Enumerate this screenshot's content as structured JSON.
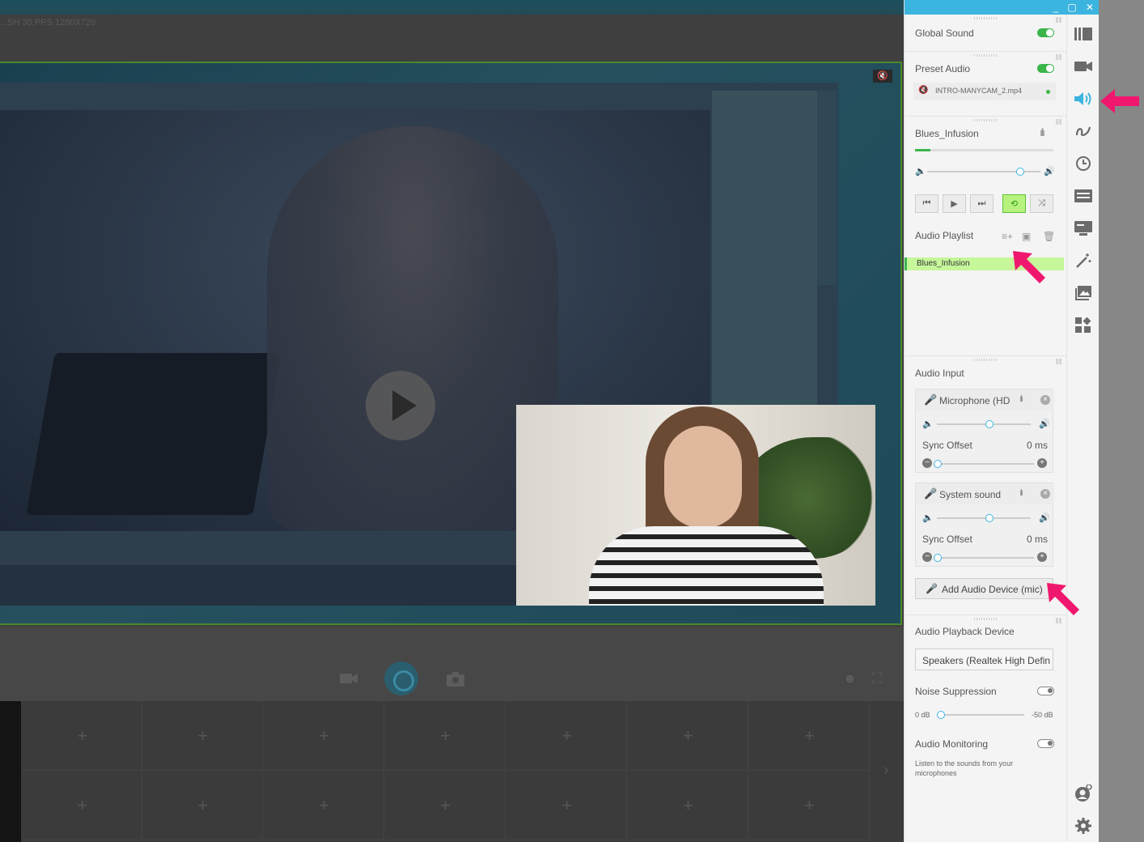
{
  "stage": {
    "stats_text": "...SH 30.PPS 1280X720",
    "bottom_controls": [
      "camera-icon",
      "broadcast-icon",
      "snapshot-icon"
    ],
    "grid_plus": "+",
    "next_arrow": "›"
  },
  "panel": {
    "window_buttons": {
      "minimize": "_",
      "maximize": "▢",
      "close": "✕"
    },
    "global_sound": {
      "label": "Global Sound",
      "enabled": true
    },
    "preset_audio": {
      "label": "Preset Audio",
      "enabled": true,
      "file": "INTRO-MANYCAM_2.mp4"
    },
    "player": {
      "track": "Blues_Infusion",
      "progress_fraction": 0.11,
      "volume_fraction": 0.84,
      "buttons": [
        "⏮",
        "▶",
        "⏭",
        "⟲",
        "⤨"
      ]
    },
    "playlist": {
      "label": "Audio Playlist",
      "items": [
        "Blues_Infusion"
      ]
    },
    "audio_input": {
      "label": "Audio Input",
      "devices": [
        {
          "name": "Microphone (HD",
          "volume_fraction": 0.55,
          "sync_label": "Sync Offset",
          "sync_value": "0 ms"
        },
        {
          "name": "System sound",
          "volume_fraction": 0.55,
          "sync_label": "Sync Offset",
          "sync_value": "0 ms"
        }
      ],
      "add_device": "Add Audio Device (mic)"
    },
    "playback": {
      "label": "Audio Playback Device",
      "device": "Speakers (Realtek High Defin"
    },
    "noise": {
      "label": "Noise Suppression",
      "enabled": false,
      "min": "0 dB",
      "max": "-50 dB"
    },
    "monitoring": {
      "label": "Audio Monitoring",
      "enabled": false,
      "hint": "Listen to the sounds from your microphones"
    }
  },
  "rail": {
    "icons": [
      "presets-icon",
      "video-icon",
      "audio-icon",
      "draw-icon",
      "history-icon",
      "lower-thirds-icon",
      "screen-icon",
      "effects-icon",
      "images-icon",
      "widgets-icon"
    ],
    "bottom_icons": [
      "account-icon",
      "settings-icon"
    ]
  },
  "colors": {
    "accent": "#3cb4e0",
    "green": "#3bb54a",
    "highlight": "#c6f79b",
    "arrow": "#f0186e"
  }
}
